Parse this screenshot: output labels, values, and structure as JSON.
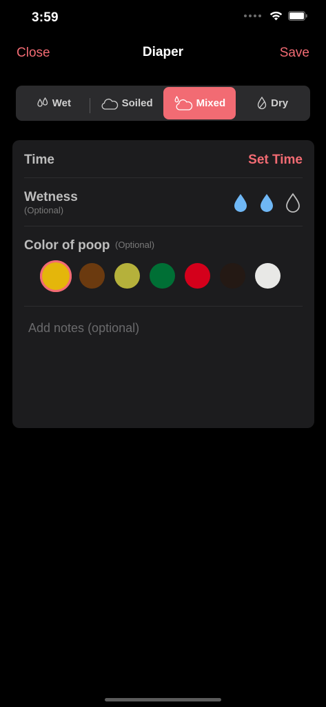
{
  "status": {
    "time": "3:59"
  },
  "nav": {
    "close": "Close",
    "title": "Diaper",
    "save": "Save"
  },
  "segments": [
    {
      "label": "Wet",
      "icon": "drops-icon"
    },
    {
      "label": "Soiled",
      "icon": "cloud-icon"
    },
    {
      "label": "Mixed",
      "icon": "cloud-drop-icon",
      "active": true
    },
    {
      "label": "Dry",
      "icon": "leaf-drop-icon"
    }
  ],
  "time": {
    "label": "Time",
    "action": "Set Time"
  },
  "wetness": {
    "label": "Wetness",
    "optional": "(Optional)",
    "level": 2,
    "max": 3
  },
  "color": {
    "label": "Color of poop",
    "optional": "(Optional)",
    "selected_index": 0,
    "swatches": [
      "#e4b60b",
      "#6b3a0f",
      "#b5b13b",
      "#006f35",
      "#d4001b",
      "#241914",
      "#e8e8e6"
    ]
  },
  "notes": {
    "placeholder": "Add notes (optional)"
  },
  "colors": {
    "accent": "#f26b73",
    "drop": "#6fb7f5"
  }
}
